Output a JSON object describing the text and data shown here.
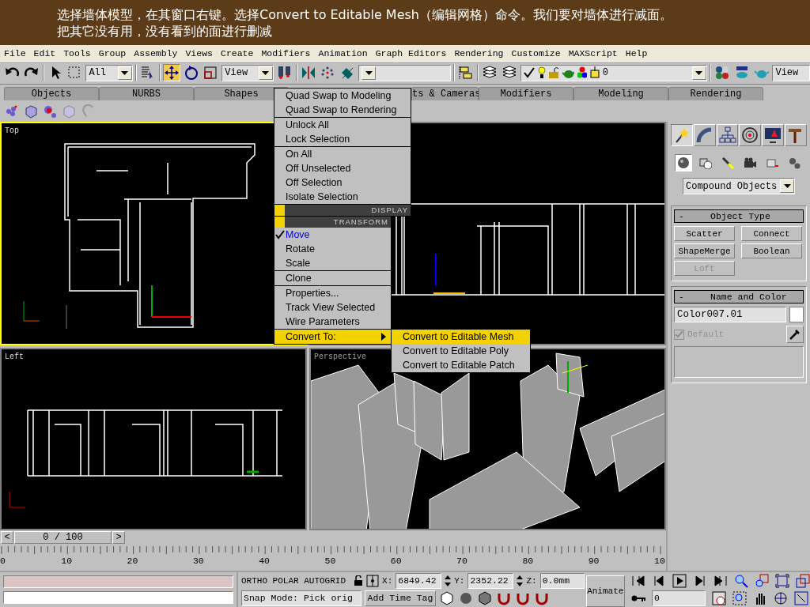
{
  "banner": {
    "lines": [
      "选择墙体模型，在其窗口右键。选择Convert to Editable Mesh（编辑网格）命令。我们要对墙体进行减面。",
      "把其它没有用，没有看到的面进行删减"
    ]
  },
  "menu_bar": [
    {
      "label": "File"
    },
    {
      "label": "Edit"
    },
    {
      "label": "Tools"
    },
    {
      "label": "Group"
    },
    {
      "label": "Assembly"
    },
    {
      "label": "Views"
    },
    {
      "label": "Create"
    },
    {
      "label": "Modifiers"
    },
    {
      "label": "Animation"
    },
    {
      "label": "Graph Editors"
    },
    {
      "label": "Rendering"
    },
    {
      "label": "Customize"
    },
    {
      "label": "MAXScript"
    },
    {
      "label": "Help"
    }
  ],
  "toolbar": [
    {
      "kind": "undo",
      "selected": false
    },
    {
      "kind": "redo",
      "selected": false
    },
    {
      "kind": "sep"
    },
    {
      "kind": "select",
      "selected": false
    },
    {
      "kind": "region",
      "selected": false
    },
    {
      "kind": "combo",
      "value": "All"
    },
    {
      "kind": "sep"
    },
    {
      "kind": "list",
      "selected": false
    },
    {
      "kind": "sep"
    },
    {
      "kind": "move",
      "selected": true
    },
    {
      "kind": "rotate",
      "selected": false
    },
    {
      "kind": "scale",
      "selected": false
    },
    {
      "kind": "combo",
      "value": "View"
    },
    {
      "kind": "pivot",
      "selected": false
    },
    {
      "kind": "sep"
    },
    {
      "kind": "mirror",
      "selected": false
    },
    {
      "kind": "array",
      "selected": false
    },
    {
      "kind": "align",
      "selected": false
    },
    {
      "kind": "named"
    },
    {
      "kind": "sep"
    },
    {
      "kind": "curve",
      "selected": false
    },
    {
      "kind": "sep"
    },
    {
      "kind": "layers",
      "selected": false
    },
    {
      "kind": "layers",
      "selected": false
    },
    {
      "kind": "layer",
      "value": "0"
    },
    {
      "kind": "sep"
    },
    {
      "kind": "material",
      "selected": false
    },
    {
      "kind": "render",
      "selected": false
    },
    {
      "kind": "teapot",
      "selected": false
    },
    {
      "kind": "field",
      "value": "View"
    }
  ],
  "tab_panel": [
    {
      "label": "Objects"
    },
    {
      "label": "NURBS"
    },
    {
      "label": "Shapes"
    },
    {
      "label": "ts & Cameras"
    },
    {
      "label": "Modifiers"
    },
    {
      "label": "Modeling"
    },
    {
      "label": "Rendering"
    }
  ],
  "viewports": [
    {
      "label": "Top",
      "kind": "top",
      "active": true
    },
    {
      "kind": "front",
      "active": false
    },
    {
      "label": "Left",
      "kind": "left",
      "active": false
    },
    {
      "label": "Perspective",
      "kind": "persp",
      "active": false
    }
  ],
  "quad_menu": {
    "display": {
      "header": "DISPLAY",
      "groups": [
        [
          {
            "label": "Quad Swap to Modeling",
            "selected": false
          },
          {
            "label": "Quad Swap to Rendering",
            "selected": false
          }
        ],
        [
          {
            "label": "Unlock All",
            "selected": false
          },
          {
            "label": "Lock Selection",
            "selected": false
          }
        ],
        [
          {
            "label": "On All",
            "selected": false
          },
          {
            "label": "Off Unselected",
            "selected": false
          },
          {
            "label": "Off Selection",
            "selected": false
          },
          {
            "label": "Isolate Selection",
            "selected": false
          }
        ]
      ]
    },
    "transform": {
      "header": "TRANSFORM",
      "groups": [
        [
          {
            "label": "Move",
            "checked": true,
            "selected": false,
            "submenu": false
          },
          {
            "label": "Rotate",
            "checked": false,
            "selected": false,
            "submenu": false
          },
          {
            "label": "Scale",
            "checked": false,
            "selected": false,
            "submenu": false
          }
        ],
        [
          {
            "label": "Clone",
            "checked": false,
            "selected": false,
            "submenu": false
          }
        ],
        [
          {
            "label": "Properties...",
            "checked": false,
            "selected": false,
            "submenu": false
          },
          {
            "label": "Track View Selected",
            "checked": false,
            "selected": false,
            "submenu": false
          },
          {
            "label": "Wire Parameters",
            "checked": false,
            "selected": false,
            "submenu": false
          }
        ],
        [
          {
            "label": "Convert To:",
            "checked": false,
            "selected": true,
            "submenu": true
          }
        ]
      ]
    },
    "submenu": [
      {
        "label": "Convert to Editable Mesh",
        "selected": true
      },
      {
        "label": "Convert to Editable Poly",
        "selected": false
      },
      {
        "label": "Convert to Editable Patch",
        "selected": false
      }
    ]
  },
  "command_panel": {
    "tabs": [
      {
        "kind": "create",
        "selected": true
      },
      {
        "kind": "modify",
        "selected": false
      },
      {
        "kind": "hierarchy",
        "selected": false
      },
      {
        "kind": "motion",
        "selected": false
      },
      {
        "kind": "display",
        "selected": false
      },
      {
        "kind": "utilities",
        "selected": false
      }
    ],
    "categories": [
      {
        "kind": "geometry",
        "selected": true
      },
      {
        "kind": "shapes",
        "selected": false
      },
      {
        "kind": "lights",
        "selected": false
      },
      {
        "kind": "cameras",
        "selected": false
      },
      {
        "kind": "helpers",
        "selected": false
      },
      {
        "kind": "systems",
        "selected": false
      }
    ],
    "dropdown": "Compound Objects",
    "object_type": {
      "toggle": "-",
      "title": "Object Type",
      "buttons": [
        {
          "label": "Scatter",
          "disabled": false
        },
        {
          "label": "Connect",
          "disabled": false
        },
        {
          "label": "ShapeMerge",
          "disabled": false
        },
        {
          "label": "Boolean",
          "disabled": false
        },
        {
          "label": "Loft",
          "disabled": true
        }
      ]
    },
    "name_and_color": {
      "toggle": "-",
      "title": "Name and Color",
      "name": "Color007.01",
      "color": "#ffffff",
      "default_label": "Default",
      "default_checked": true
    }
  },
  "time_slider": {
    "prev": "<",
    "position": "0 / 100",
    "next": ">"
  },
  "ruler_labels": [
    "0",
    "10",
    "20",
    "30",
    "40",
    "50",
    "60",
    "70",
    "80",
    "90",
    "10"
  ],
  "status": {
    "modes": [
      "ORTHO",
      "POLAR",
      "AUTOGRID"
    ],
    "coords": [
      {
        "axis": "X:",
        "value": "6849.42"
      },
      {
        "axis": "Y:",
        "value": "2352.22"
      },
      {
        "axis": "Z:",
        "value": "0.0mm"
      }
    ],
    "snap_mode": "Snap Mode: Pick orig",
    "add_time_tag": "Add Time Tag",
    "animate": "Animate",
    "frame": "0"
  }
}
